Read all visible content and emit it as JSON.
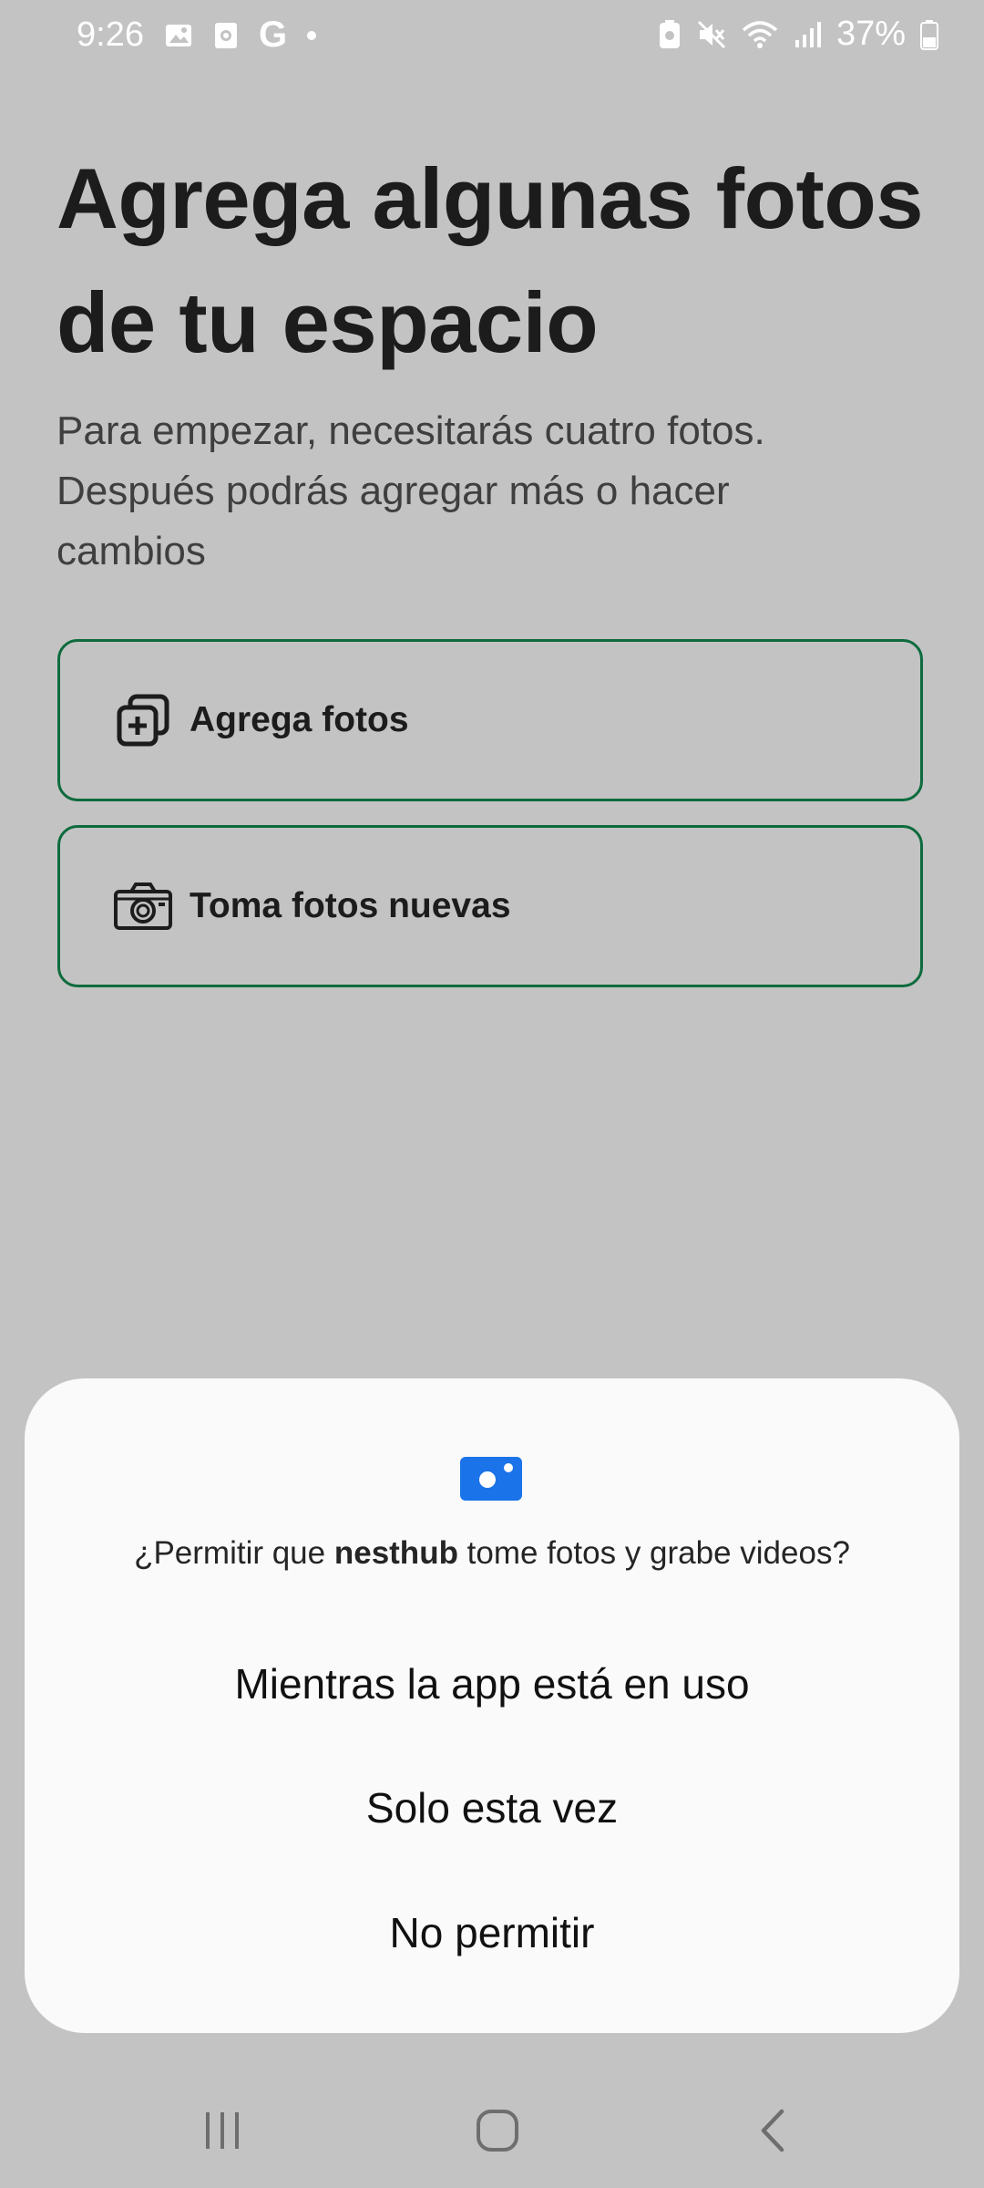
{
  "status_bar": {
    "time": "9:26",
    "battery": "37%",
    "icons": [
      "gallery-icon",
      "screen-recorder-icon",
      "google-icon",
      "dot-icon",
      "battery-saver-icon",
      "mute-icon",
      "wifi-icon",
      "signal-icon",
      "battery-icon"
    ],
    "google_letter": "G"
  },
  "main": {
    "title": "Agrega algunas fotos de tu espacio",
    "subtitle": "Para empezar, necesitarás cuatro fotos. Después podrás agregar más o hacer cambios",
    "buttons": [
      {
        "label": "Agrega fotos",
        "icon": "add-photos-icon"
      },
      {
        "label": "Toma fotos nuevas",
        "icon": "camera-icon"
      }
    ],
    "accent_color": "#0d6b3d"
  },
  "permission_dialog": {
    "icon": "camera-permission-icon",
    "icon_color": "#1a73e8",
    "question_prefix": "¿Permitir que ",
    "app_name": "nesthub",
    "question_suffix": " tome fotos y grabe videos?",
    "options": [
      "Mientras la app está en uso",
      "Solo esta vez",
      "No permitir"
    ]
  },
  "nav_bar": {
    "buttons": [
      "recents-icon",
      "home-icon",
      "back-icon"
    ]
  }
}
